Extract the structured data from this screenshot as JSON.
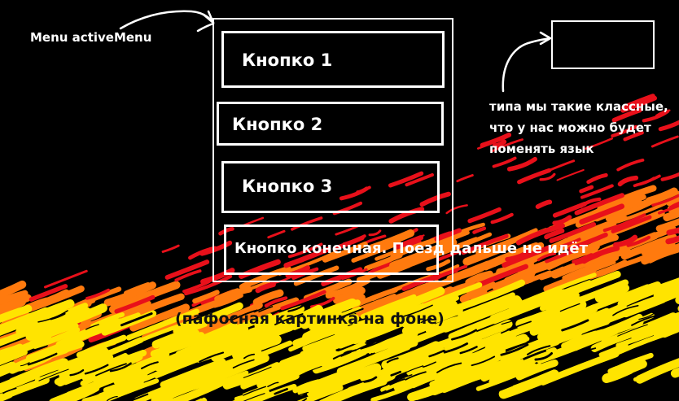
{
  "annotations": {
    "menu_label": "Menu activeMenu",
    "lang_note": "типа мы такие классные, что у нас можно будет поменять язык",
    "background_note": "(пафосная картинка на фоне)"
  },
  "menu": {
    "buttons": [
      {
        "label": "Кнопко 1"
      },
      {
        "label": "Кнопко 2"
      },
      {
        "label": "Кнопко 3"
      },
      {
        "label": "Кнопко конечная. Поезд дальше не идёт"
      }
    ]
  },
  "colors": {
    "background": "#000000",
    "stroke": "#ffffff",
    "fire_red": "#e8101a",
    "fire_orange": "#ff7a0e",
    "fire_yellow": "#ffe400"
  },
  "icons": {
    "menu_pointer": "curved-arrow-icon",
    "language_pointer": "curved-arrow-icon"
  }
}
